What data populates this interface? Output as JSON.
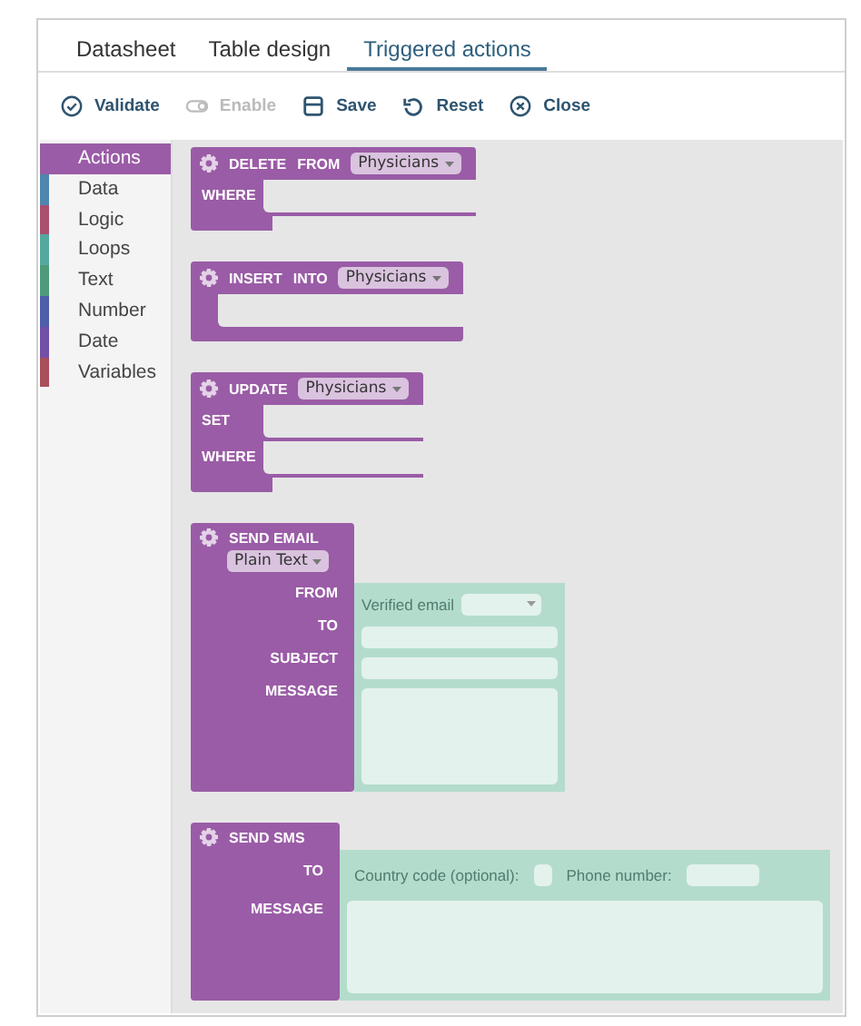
{
  "tabs": [
    {
      "label": "Datasheet",
      "selected": false
    },
    {
      "label": "Table design",
      "selected": false
    },
    {
      "label": "Triggered actions",
      "selected": true
    }
  ],
  "toolbar": [
    {
      "kind": "validate",
      "label": "Validate",
      "disabled": false
    },
    {
      "kind": "enable",
      "label": "Enable",
      "disabled": true
    },
    {
      "kind": "save",
      "label": "Save",
      "disabled": false
    },
    {
      "kind": "reset",
      "label": "Reset",
      "disabled": false
    },
    {
      "kind": "close",
      "label": "Close",
      "disabled": false
    }
  ],
  "toolbox": [
    {
      "label": "Actions",
      "selected": true,
      "color": "#9a5ca6"
    },
    {
      "label": "Data",
      "selected": false,
      "color": "#4f86b0"
    },
    {
      "label": "Logic",
      "selected": false,
      "color": "#a8506e"
    },
    {
      "label": "Loops",
      "selected": false,
      "color": "#55a89e"
    },
    {
      "label": "Text",
      "selected": false,
      "color": "#4f9a7a"
    },
    {
      "label": "Number",
      "selected": false,
      "color": "#4f5ea8"
    },
    {
      "label": "Date",
      "selected": false,
      "color": "#7250a6"
    },
    {
      "label": "Variables",
      "selected": false,
      "color": "#a84f5a"
    }
  ],
  "blocks": [
    {
      "kind": "sql",
      "keywords": [
        "DELETE",
        "FROM"
      ],
      "table": "Physicians",
      "slots": [
        {
          "kind": "statement",
          "label": "WHERE"
        }
      ]
    },
    {
      "kind": "sql",
      "keywords": [
        "INSERT",
        "INTO"
      ],
      "table": "Physicians",
      "slots": [
        {
          "kind": "statement"
        }
      ]
    },
    {
      "kind": "sql",
      "keywords": [
        "UPDATE"
      ],
      "table": "Physicians",
      "slots": [
        {
          "kind": "statement",
          "label": "SET"
        },
        {
          "kind": "statement",
          "label": "WHERE"
        }
      ]
    },
    {
      "kind": "email",
      "title": "SEND EMAIL",
      "format": "Plain Text",
      "rows": [
        {
          "label": "FROM",
          "kind": "select",
          "text": "Verified email"
        },
        {
          "label": "TO",
          "kind": "input"
        },
        {
          "label": "SUBJECT",
          "kind": "input"
        },
        {
          "label": "MESSAGE",
          "kind": "textarea"
        }
      ]
    },
    {
      "kind": "sms",
      "title": "SEND SMS",
      "rows": [
        {
          "label": "TO",
          "kind": "phone",
          "country_label": "Country code (optional):",
          "phone_label": "Phone number:"
        },
        {
          "label": "MESSAGE",
          "kind": "textarea"
        }
      ]
    }
  ]
}
